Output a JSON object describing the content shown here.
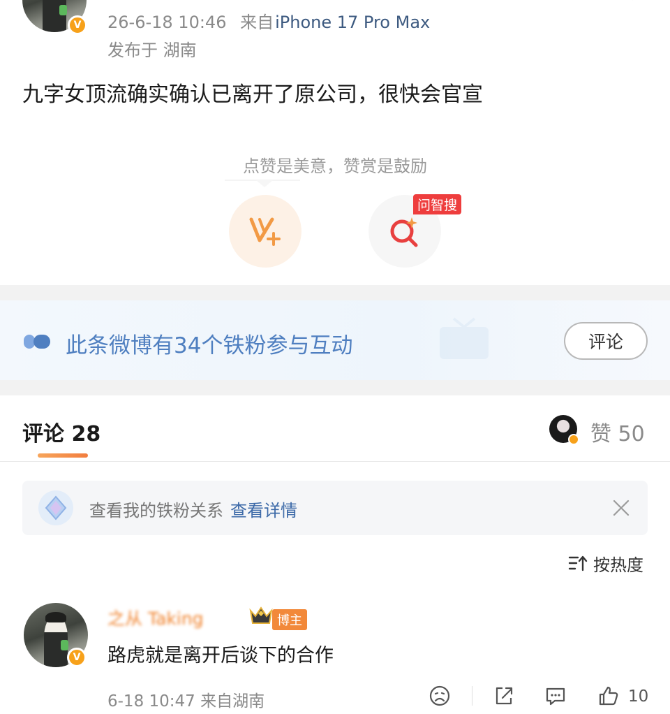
{
  "post": {
    "time": "26-6-18 10:46",
    "source_prefix": "来自",
    "device": "iPhone 17 Pro Max",
    "location": "发布于 湖南",
    "text": "九字女顶流确实确认已离开了原公司，很快会官宣"
  },
  "reward": {
    "tip": "点赞是美意，赞赏是鼓励",
    "search_tag": "问智搜"
  },
  "fans_banner": {
    "text": "此条微博有34个铁粉参与互动",
    "comment_button": "评论"
  },
  "comments_tab": {
    "label": "评论 28",
    "likes_label": "赞 50"
  },
  "fans_notice": {
    "text": "查看我的铁粉关系",
    "link": "查看详情"
  },
  "sort": {
    "label": "按热度"
  },
  "comment": {
    "user": "之从 Taking",
    "badge": "博主",
    "text": "路虎就是离开后谈下的合作",
    "meta": "6-18 10:47 来自湖南",
    "like_count": "10"
  },
  "colors": {
    "accent_orange": "#f27d3e",
    "link_blue": "#3d6aa8",
    "banner_blue": "#4f7fc0",
    "verified_badge": "#f7a11a",
    "tag_red": "#ee3d3d"
  }
}
